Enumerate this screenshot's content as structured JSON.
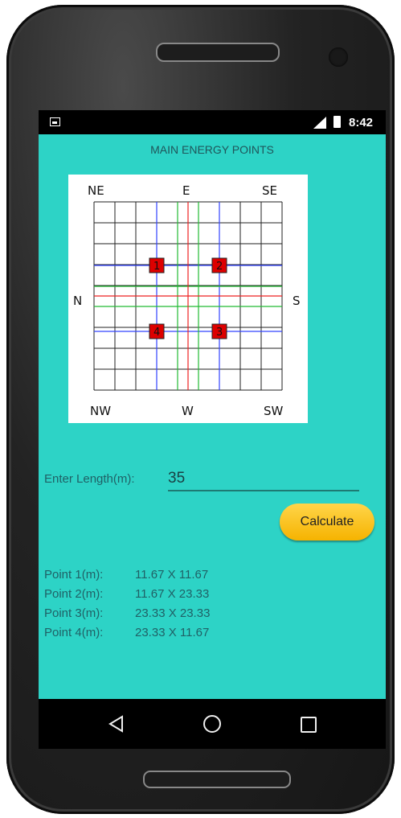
{
  "status_bar": {
    "time": "8:42"
  },
  "screen": {
    "title": "MAIN ENERGY POINTS",
    "diagram": {
      "labels": {
        "ne": "NE",
        "e": "E",
        "se": "SE",
        "n": "N",
        "s": "S",
        "nw": "NW",
        "w": "W",
        "sw": "SW"
      },
      "points": [
        "1",
        "2",
        "3",
        "4"
      ]
    },
    "length_label": "Enter Length(m):",
    "length_value": "35",
    "calculate_label": "Calculate",
    "results": [
      {
        "label": "Point 1(m):",
        "value": "11.67 X 11.67"
      },
      {
        "label": "Point 2(m):",
        "value": "11.67 X 23.33"
      },
      {
        "label": "Point 3(m):",
        "value": "23.33 X 23.33"
      },
      {
        "label": "Point 4(m):",
        "value": "23.33 X 11.67"
      }
    ]
  },
  "colors": {
    "screen_background": "#2dd3c6",
    "button": "#f6b300",
    "point_marker": "#dd0000"
  },
  "icons": {
    "status": [
      "notification-image-icon",
      "signal-icon",
      "battery-icon"
    ],
    "navigation": [
      "back-icon",
      "home-icon",
      "recent-apps-icon"
    ]
  }
}
